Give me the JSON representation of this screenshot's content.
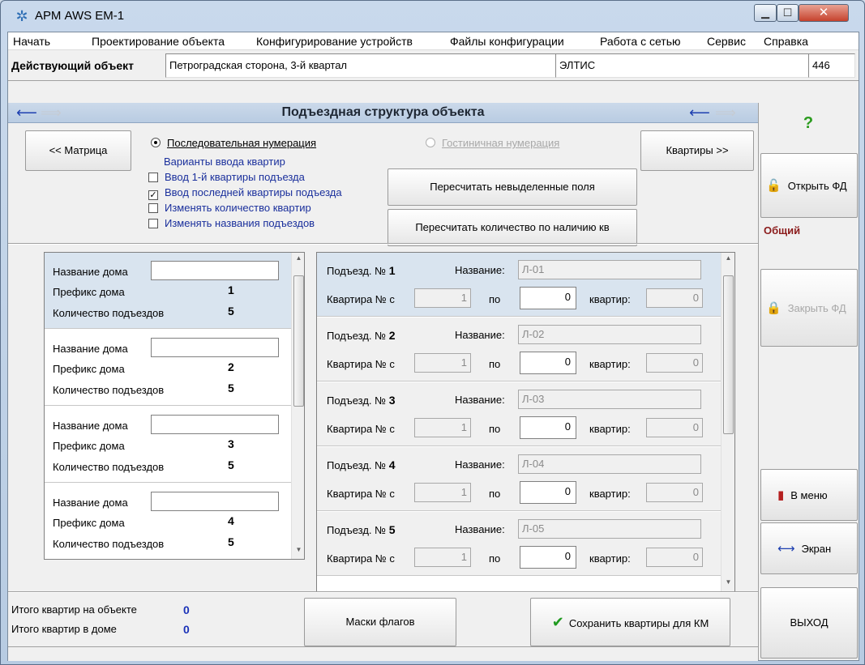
{
  "window": {
    "title": "АРМ AWS EM-1"
  },
  "menu": [
    "Начать",
    "Проектирование объекта",
    "Конфигурирование устройств",
    "Файлы конфигурации",
    "Работа с сетью",
    "Сервис",
    "Справка"
  ],
  "object": {
    "label": "Действующий объект",
    "name": "Петроградская сторона, 3-й квартал",
    "org": "ЭЛТИС",
    "number": "446"
  },
  "header": {
    "title": "Подъездная структура объекта"
  },
  "controls": {
    "matrix_button": "<< Матрица",
    "apartments_button": "Квартиры >>",
    "radio_sequential": "Последовательная нумерация",
    "radio_hotel": "Гостиничная нумерация",
    "variants_label": "Варианты ввода квартир",
    "checkboxes": [
      {
        "label": "Ввод 1-й квартиры подъезда",
        "checked": false
      },
      {
        "label": "Ввод последней квартиры подъезда",
        "checked": true
      },
      {
        "label": "Изменять количество квартир",
        "checked": false
      },
      {
        "label": "Изменять названия подъездов",
        "checked": false
      }
    ],
    "recalc_unselected": "Пересчитать невыделенные поля",
    "recalc_by_presence": "Пересчитать количество по наличию кв"
  },
  "houses": {
    "name_label": "Название дома",
    "prefix_label": "Префикс дома",
    "entrances_label": "Количество подъездов",
    "items": [
      {
        "prefix": "1",
        "entrances": "5"
      },
      {
        "prefix": "2",
        "entrances": "5"
      },
      {
        "prefix": "3",
        "entrances": "5"
      },
      {
        "prefix": "4",
        "entrances": "5"
      }
    ]
  },
  "entrances": {
    "entrance_label": "Подъезд. №",
    "name_label": "Название:",
    "apt_from_label": "Квартира № с",
    "to_label": "по",
    "apts_label": "квартир:",
    "items": [
      {
        "num": "1",
        "name": "Л-01",
        "from": "1",
        "to": "0",
        "count": "0"
      },
      {
        "num": "2",
        "name": "Л-02",
        "from": "1",
        "to": "0",
        "count": "0"
      },
      {
        "num": "3",
        "name": "Л-03",
        "from": "1",
        "to": "0",
        "count": "0"
      },
      {
        "num": "4",
        "name": "Л-04",
        "from": "1",
        "to": "0",
        "count": "0"
      },
      {
        "num": "5",
        "name": "Л-05",
        "from": "1",
        "to": "0",
        "count": "0"
      }
    ]
  },
  "sidebar": {
    "help": "?",
    "open_fd": "Открыть ФД",
    "common": "Общий",
    "close_fd": "Закрыть ФД",
    "to_menu": "В меню",
    "screen": "Экран",
    "exit": "ВЫХОД"
  },
  "totals": {
    "object_label": "Итого квартир на объекте",
    "object_value": "0",
    "house_label": "Итого квартир в доме",
    "house_value": "0"
  },
  "bottom": {
    "masks_button": "Маски флагов",
    "save_button": "Сохранить квартиры для КМ"
  }
}
